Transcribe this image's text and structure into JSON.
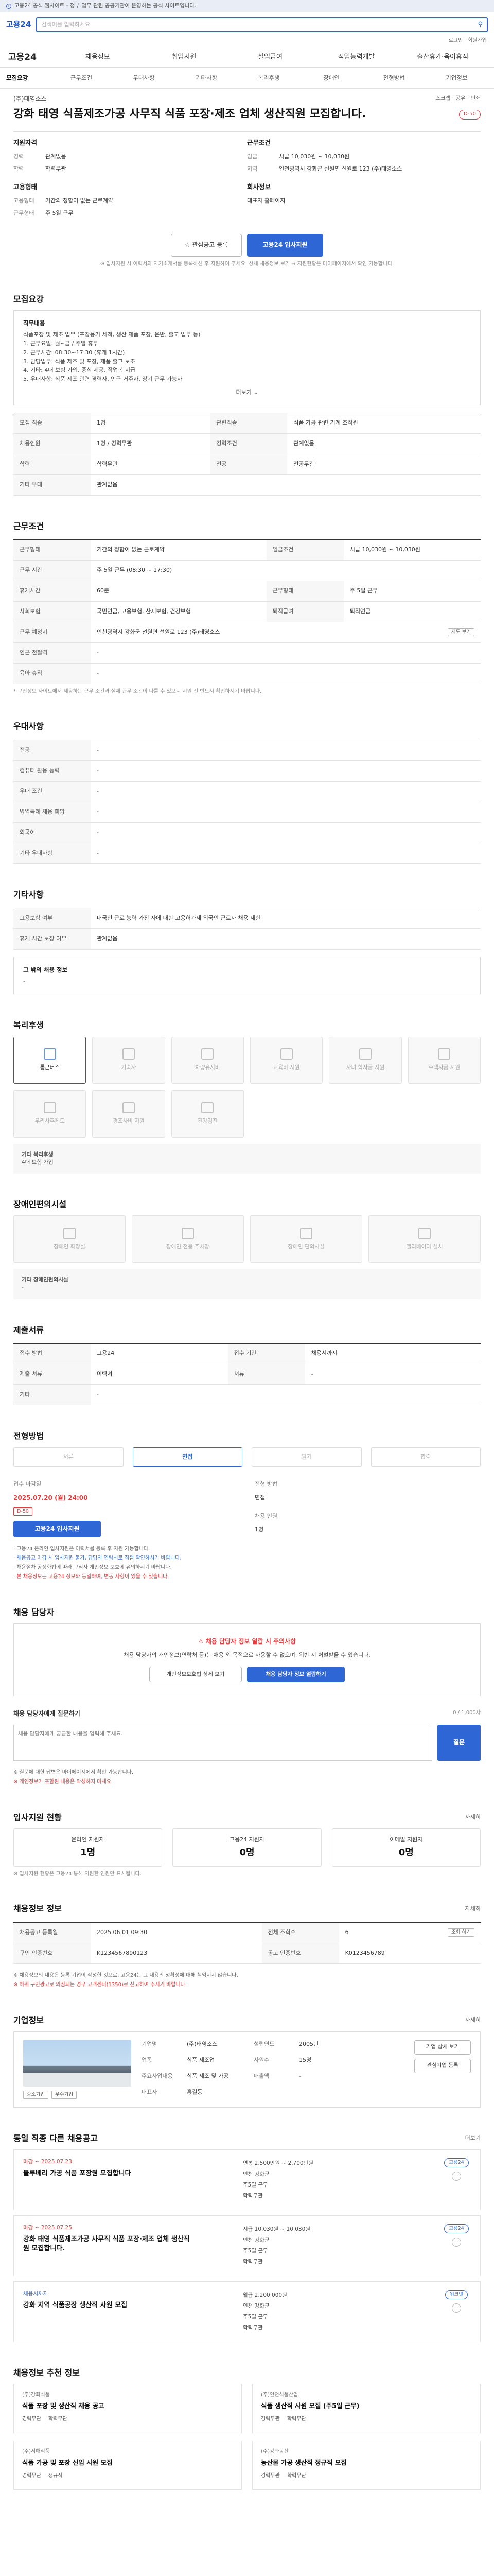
{
  "notice": "고용24 공식 웹사이트 - 정부 업무 관련 공공기관이 운영하는 공식 사이트입니다.",
  "header": {
    "logo": "고용24",
    "search_placeholder": "검색어를 입력하세요",
    "util": [
      "로그인",
      "회원가입"
    ]
  },
  "gnb": {
    "logo": "고용24",
    "items": [
      "채용정보",
      "취업지원",
      "실업급여",
      "직업능력개발",
      "출산휴가·육아휴직"
    ]
  },
  "tabs": [
    "모집요강",
    "근무조건",
    "우대사항",
    "기타사항",
    "복리후생",
    "장애인",
    "전형방법",
    "기업정보"
  ],
  "job": {
    "company": "(주)태영소스",
    "actions": "스크랩 · 공유 · 인쇄",
    "title": "강화 태영 식품제조가공 사무직 식품 포장·제조 업체 생산직원 모집합니다.",
    "dday": "D-50",
    "summary": {
      "h1": "지원자격",
      "h2": "근무조건",
      "h3": "고용형태",
      "h4": "회사정보",
      "rows1": [
        [
          "경력",
          "관계없음"
        ],
        [
          "학력",
          "학력무관"
        ]
      ],
      "rows2": [
        [
          "임금",
          "시급 10,030원 ~ 10,030원"
        ],
        [
          "지역",
          "인천광역시 강화군 선원면 선원로 123 (주)태영소스"
        ]
      ],
      "rows3": [
        [
          "고용형태",
          "기간의 정함이 없는 근로계약"
        ],
        [
          "근무형태",
          "주 5일 근무"
        ]
      ],
      "rows4": [
        [
          "",
          "대표자 홈페이지"
        ]
      ]
    },
    "scrap_label": "관심공고 등록",
    "apply_label": "고용24 입사지원",
    "apply_hint": "※ 입사지원 시 이력서와 자기소개서를 등록하신 후 지원하여 주세요. 상세 채용정보 보기 → 지원현황은 마이페이지에서 확인 가능합니다."
  },
  "recruit": {
    "heading": "모집요강",
    "box_title": "직무내용",
    "box_text": "식품포장 및 제조 업무 (포장용기 세척, 생산 제품 포장, 운반, 출고 업무 등)",
    "list": [
      "1. 근무요일: 월~금 / 주말 휴무",
      "2. 근무시간: 08:30~17:30 (휴게 1시간)",
      "3. 담당업무: 식품 제조 및 포장, 제품 출고 보조",
      "4. 기타: 4대 보험 가입, 중식 제공, 작업복 지급",
      "5. 우대사항: 식품 제조 관련 경력자, 인근 거주자, 장기 근무 가능자"
    ],
    "more": "더보기",
    "table": [
      [
        "모집 직종",
        "1명",
        "관련직종",
        "식품 가공 관련 기계 조작원"
      ],
      [
        "채용인원",
        "1명 / 경력무관",
        "경력조건",
        "관계없음"
      ],
      [
        "학력",
        "학력무관",
        "전공",
        "전공무관"
      ],
      [
        "기타 우대",
        "관계없음",
        "",
        ""
      ]
    ]
  },
  "work": {
    "heading": "근무조건",
    "rows": [
      [
        "근무형태",
        "기간의 정함이 없는 근로계약",
        "임금조건",
        "시급 10,030원 ~ 10,030원"
      ],
      [
        "근무 시간",
        "주 5일 근무 (08:30 ~ 17:30)",
        "",
        ""
      ],
      [
        "휴게시간",
        "60분",
        "근무형태",
        "주 5일 근무"
      ],
      [
        "사회보험",
        "국민연금, 고용보험, 산재보험, 건강보험",
        "퇴직급여",
        "퇴직연금"
      ],
      [
        "근무 예정지",
        "인천광역시 강화군 선원면 선원로 123 (주)태영소스",
        "",
        ""
      ],
      [
        "인근 전철역",
        "-",
        "",
        ""
      ],
      [
        "육아 휴직",
        "-",
        "",
        ""
      ]
    ],
    "map_btn": "지도 보기",
    "note": "* 구인정보 사이트에서 제공하는 근무 조건과 실제 근무 조건이 다를 수 있으니 지원 전 반드시 확인하시기 바랍니다."
  },
  "prefer": {
    "heading": "우대사항",
    "rows": [
      [
        "전공",
        "-"
      ],
      [
        "컴퓨터 활용 능력",
        "-"
      ],
      [
        "우대 조건",
        "-"
      ],
      [
        "병역특례 채용 희망",
        "-"
      ],
      [
        "외국어",
        "-"
      ],
      [
        "기타 우대사항",
        "-"
      ]
    ]
  },
  "etc": {
    "heading": "기타사항",
    "rows": [
      [
        "고용보험 여부",
        "내국인 근로 능력 가진 자에 대한 고용허가제 외국인 근로자 채용 제한"
      ],
      [
        "휴게 시간 보장 여부",
        "관계없음"
      ]
    ],
    "extra_title": "그 밖의 채용 정보",
    "extra_text": "-"
  },
  "welfare": {
    "heading": "복리후생",
    "items": [
      {
        "label": "통근버스",
        "on": true
      },
      {
        "label": "기숙사",
        "on": false
      },
      {
        "label": "차량유지비",
        "on": false
      },
      {
        "label": "교육비 지원",
        "on": false
      },
      {
        "label": "자녀 학자금 지원",
        "on": false
      },
      {
        "label": "주택자금 지원",
        "on": false
      },
      {
        "label": "우리사주제도",
        "on": false
      },
      {
        "label": "경조사비 지원",
        "on": false
      },
      {
        "label": "건강검진",
        "on": false
      }
    ],
    "extra_title": "기타 복리후생",
    "extra_text": "4대 보험 가입"
  },
  "disability": {
    "heading": "장애인편의시설",
    "items": [
      "장애인 화장실",
      "장애인 전용 주차장",
      "장애인 편의시설",
      "엘리베이터 설치"
    ],
    "extra_title": "기타 장애인편의시설",
    "extra_text": "-"
  },
  "materials": {
    "heading": "제출서류",
    "rows": [
      [
        "접수 방법",
        "고용24",
        "접수 기간",
        "채용시까지"
      ],
      [
        "제출 서류",
        "이력서",
        "서류",
        "-"
      ],
      [
        "기타",
        "-",
        "",
        ""
      ]
    ]
  },
  "process": {
    "heading": "전형방법",
    "steps": [
      "서류",
      "면접",
      "필기",
      "합격"
    ],
    "on": 1,
    "rows": [
      [
        "접수 마감일",
        "2025.07.20 (월) 24:00",
        "전형 방법",
        "면접"
      ]
    ],
    "deadline_badge": "D-50",
    "apply_btn": "고용24 입사지원",
    "people_label": "채용 인원",
    "people_value": "1명",
    "bullets": [
      "· 고용24 온라인 입사지원은 이력서를 등록 후 지원 가능합니다.",
      "· 채용공고 마감 시 입사지원 불가, 담당자 연락처로 직접 확인하시기 바랍니다.",
      "· 채용절차 공정화법에 따라 구직자 개인정보 보호에 유의하시기 바랍니다.",
      "· 본 채용정보는 고용24 정보와 동일하며, 변동 사항이 있을 수 있습니다."
    ]
  },
  "contact": {
    "heading": "채용 담당자",
    "badge": "채용 담당자 정보 열람 시 주의사항",
    "text": "채용 담당자의 개인정보(연락처 등)는 채용 외 목적으로 사용할 수 없으며, 위반 시 처벌받을 수 있습니다.",
    "btn1": "개인정보보호법 상세 보기",
    "btn2": "채용 담당자 정보 열람하기",
    "q_title": "채용 담당자에게 질문하기",
    "q_count": "0 / 1,000자",
    "q_placeholder": "채용 담당자에게 궁금한 내용을 입력해 주세요.",
    "q_btn": "질문",
    "q_note1": "※ 질문에 대한 답변은 마이페이지에서 확인 가능합니다.",
    "q_note2": "※ 개인정보가 포함된 내용은 작성하지 마세요."
  },
  "stats": {
    "heading": "입사지원 현황",
    "more": "자세히",
    "items": [
      [
        "온라인 지원자",
        "1명"
      ],
      [
        "고용24 지원자",
        "0명"
      ],
      [
        "이메일 지원자",
        "0명"
      ]
    ],
    "note": "※ 입사지원 현황은 고용24 통해 지원한 인원만 표시됩니다."
  },
  "info": {
    "heading": "채용정보 정보",
    "more": "자세히",
    "rows": [
      [
        "채용공고 등록일",
        "2025.06.01 09:30",
        "전체 조회수",
        "6",
        "조회 하기"
      ],
      [
        "구인 인증번호",
        "K1234567890123",
        "공고 인증번호",
        "K0123456789",
        ""
      ]
    ],
    "bullets": [
      "※ 채용정보의 내용은 등록 기업이 작성한 것으로, 고용24는 그 내용의 정확성에 대해 책임지지 않습니다.",
      "※ 허위 구인광고로 의심되는 경우 고객센터(1350)로 신고하여 주시기 바랍니다."
    ]
  },
  "company": {
    "heading": "기업정보",
    "more": "자세히",
    "rows": [
      [
        "기업명",
        "(주)태영소스",
        "설립연도",
        "2005년"
      ],
      [
        "업종",
        "식품 제조업",
        "사원수",
        "15명"
      ],
      [
        "주요사업내용",
        "식품 제조 및 가공",
        "매출액",
        "-"
      ],
      [
        "대표자",
        "홍길동",
        "",
        ""
      ]
    ],
    "btn1": "기업 상세 보기",
    "btn2": "관심기업 등록",
    "tag1": "중소기업",
    "tag2": "우수기업"
  },
  "similar": {
    "heading": "동일 직종 다른 채용공고",
    "more": "더보기",
    "jobs": [
      {
        "date": "마감 ~ 2025.07.23",
        "title": "블루베리 가공 식품 포장원 모집합니다",
        "m": [
          "연봉 2,500만원 ~ 2,700만원",
          "인천 강화군",
          "주5일 근무",
          "학력무관"
        ],
        "pill": "고용24",
        "red": true
      },
      {
        "date": "마감 ~ 2025.07.25",
        "title": "강화 태영 식품제조가공 사무직 식품 포장·제조 업체 생산직원 모집합니다.",
        "m": [
          "시급 10,030원 ~ 10,030원",
          "인천 강화군",
          "주5일 근무",
          "학력무관"
        ],
        "pill": "고용24",
        "red": true
      },
      {
        "date": "채용시까지",
        "title": "강화 지역 식품공장 생산직 사원 모집",
        "m": [
          "월급 2,200,000원",
          "인천 강화군",
          "주5일 근무",
          "학력무관"
        ],
        "pill": "워크넷",
        "red": false
      }
    ]
  },
  "related": {
    "heading": "채용정보 추천 정보",
    "cards": [
      {
        "co": "(주)강화식품",
        "title": "식품 포장 및 생산직 채용 공고",
        "tags": [
          "경력무관",
          "학력무관"
        ]
      },
      {
        "co": "(주)인천식품산업",
        "title": "식품 생산직 사원 모집 (주5일 근무)",
        "tags": [
          "경력무관",
          "학력무관"
        ]
      },
      {
        "co": "(주)서해식품",
        "title": "식품 가공 및 포장 신입 사원 모집",
        "tags": [
          "경력무관",
          "정규직"
        ]
      },
      {
        "co": "(주)강화농산",
        "title": "농산물 가공 생산직 정규직 모집",
        "tags": [
          "경력무관",
          "학력무관"
        ]
      }
    ]
  }
}
